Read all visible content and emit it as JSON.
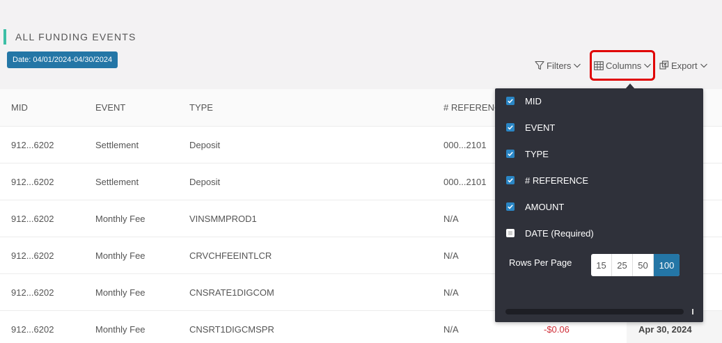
{
  "page": {
    "title": "ALL FUNDING EVENTS",
    "date_badge": "Date: 04/01/2024-04/30/2024"
  },
  "toolbar": {
    "filters": "Filters",
    "columns": "Columns",
    "export": "Export"
  },
  "table": {
    "headers": {
      "mid": "MID",
      "event": "EVENT",
      "type": "TYPE",
      "reference": "# REFERENCE"
    },
    "rows": [
      {
        "mid": "912...6202",
        "event": "Settlement",
        "type": "Deposit",
        "reference": "000...2101"
      },
      {
        "mid": "912...6202",
        "event": "Settlement",
        "type": "Deposit",
        "reference": "000...2101"
      },
      {
        "mid": "912...6202",
        "event": "Monthly Fee",
        "type": "VINSMMPROD1",
        "reference": "N/A"
      },
      {
        "mid": "912...6202",
        "event": "Monthly Fee",
        "type": "CRVCHFEEINTLCR",
        "reference": "N/A"
      },
      {
        "mid": "912...6202",
        "event": "Monthly Fee",
        "type": "CNSRATE1DIGCOM",
        "reference": "N/A"
      },
      {
        "mid": "912...6202",
        "event": "Monthly Fee",
        "type": "CNSRT1DIGCMSPR",
        "reference": "N/A",
        "amount": "-$0.06",
        "date": "Apr 30, 2024"
      }
    ]
  },
  "columns_dropdown": {
    "options": [
      {
        "label": "MID",
        "checked": true
      },
      {
        "label": "EVENT",
        "checked": true
      },
      {
        "label": "TYPE",
        "checked": true
      },
      {
        "label": "# REFERENCE",
        "checked": true
      },
      {
        "label": "AMOUNT",
        "checked": true
      },
      {
        "label": "DATE (Required)",
        "checked": false
      }
    ],
    "rows_per_page_label": "Rows Per Page",
    "rows_per_page_options": [
      "15",
      "25",
      "50",
      "100"
    ],
    "rows_per_page_selected": "100"
  },
  "colors": {
    "accent": "#2476a6",
    "title_bar": "#3dbfa6",
    "highlight": "#e00000",
    "negative": "#d0303a",
    "dropdown_bg": "#2f313a"
  }
}
